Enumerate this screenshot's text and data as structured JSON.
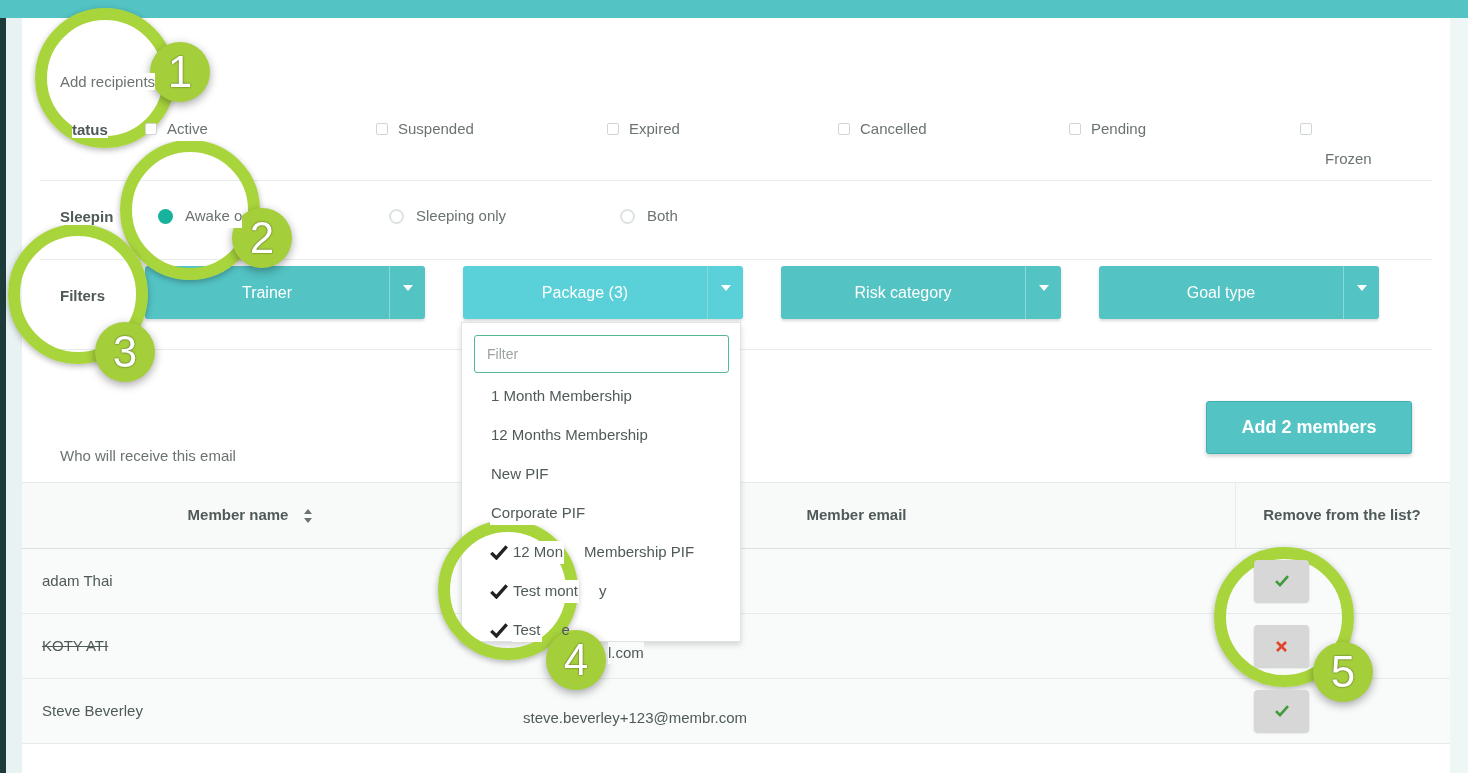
{
  "section_title": "Add recipients",
  "status": {
    "label": "tatus",
    "options": [
      {
        "label": "Active",
        "checked": false
      },
      {
        "label": "Suspended",
        "checked": false
      },
      {
        "label": "Expired",
        "checked": false
      },
      {
        "label": "Cancelled",
        "checked": false
      },
      {
        "label": "Pending",
        "checked": false
      },
      {
        "label": "Frozen",
        "checked": false
      }
    ]
  },
  "sleeping": {
    "label": "Sleepin",
    "options": [
      {
        "label": "Awake o",
        "selected": true
      },
      {
        "label": "Sleeping only",
        "selected": false
      },
      {
        "label": "Both",
        "selected": false
      }
    ]
  },
  "filters": {
    "label": "Filters",
    "dropdowns": [
      {
        "label": "Trainer",
        "open": false
      },
      {
        "label": "Package (3)",
        "open": true
      },
      {
        "label": "Risk category",
        "open": false
      },
      {
        "label": "Goal type",
        "open": false
      }
    ]
  },
  "package_menu": {
    "placeholder": "Filter",
    "items": [
      {
        "parts": [
          "1 Month Membership"
        ],
        "checked": false
      },
      {
        "parts": [
          "12 Months Membership"
        ],
        "checked": false
      },
      {
        "parts": [
          "New PIF"
        ],
        "checked": false
      },
      {
        "parts": [
          "Corporate PIF"
        ],
        "checked": false
      },
      {
        "parts": [
          "12 Mon",
          "Membership PIF"
        ],
        "checked": true
      },
      {
        "parts": [
          "Test mont",
          "y"
        ],
        "checked": true
      },
      {
        "parts": [
          "Test",
          "e"
        ],
        "checked": true
      }
    ]
  },
  "add_button": "Add 2 members",
  "recipients_caption": "Who will receive this email",
  "table": {
    "columns": [
      "Member name",
      "Member email",
      "Remove from the list?"
    ],
    "rows": [
      {
        "name": "adam Thai",
        "kind": "hidden_email",
        "included": true
      },
      {
        "name": "KOTY ATI",
        "email": "l.com",
        "kind": "partial_email",
        "included": false
      },
      {
        "name": "Steve Beverley",
        "email": "steve.beverley+123@membr.com",
        "kind": "full_email",
        "included": true
      }
    ]
  },
  "callouts": [
    {
      "number": "1"
    },
    {
      "number": "2"
    },
    {
      "number": "3"
    },
    {
      "number": "4"
    },
    {
      "number": "5"
    }
  ]
}
